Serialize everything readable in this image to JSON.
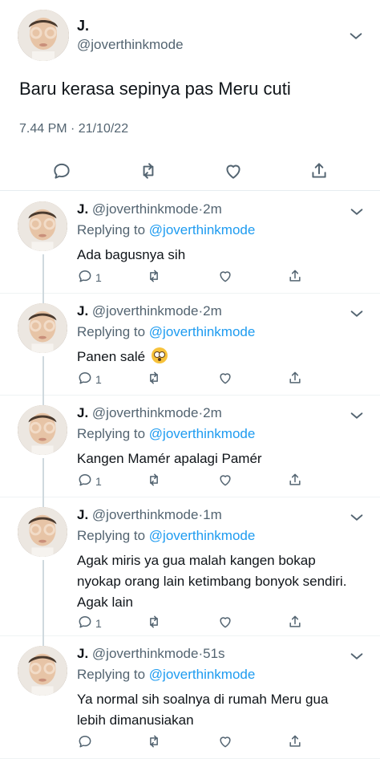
{
  "main_tweet": {
    "name": "J.",
    "handle": "@joverthinkmode",
    "text": "Baru kerasa sepinya pas Meru cuti",
    "timestamp": "7.44 PM · 21/10/22",
    "actions": [
      "reply-icon",
      "retweet-icon",
      "like-icon",
      "share-icon"
    ]
  },
  "replies": [
    {
      "name": "J.",
      "handle": "@joverthinkmode",
      "time": "2m",
      "replying_label": "Replying to",
      "replying_to": "@joverthinkmode",
      "text": "Ada bagusnya sih",
      "reply_count": "1",
      "emoji": false
    },
    {
      "name": "J.",
      "handle": "@joverthinkmode",
      "time": "2m",
      "replying_label": "Replying to",
      "replying_to": "@joverthinkmode",
      "text": "Panen salé",
      "reply_count": "1",
      "emoji": true
    },
    {
      "name": "J.",
      "handle": "@joverthinkmode",
      "time": "2m",
      "replying_label": "Replying to",
      "replying_to": "@joverthinkmode",
      "text": "Kangen Mamér apalagi Pamér",
      "reply_count": "1",
      "emoji": false
    },
    {
      "name": "J.",
      "handle": "@joverthinkmode",
      "time": "1m",
      "replying_label": "Replying to",
      "replying_to": "@joverthinkmode",
      "text": "Agak miris ya gua malah kangen bokap nyokap orang lain ketimbang bonyok sendiri. Agak lain",
      "reply_count": "1",
      "emoji": false
    },
    {
      "name": "J.",
      "handle": "@joverthinkmode",
      "time": "51s",
      "replying_label": "Replying to",
      "replying_to": "@joverthinkmode",
      "text": "Ya normal sih soalnya di rumah Meru gua lebih dimanusiakan",
      "reply_count": "",
      "emoji": false
    }
  ],
  "colors": {
    "link": "#1d9bf0",
    "muted": "#536471",
    "text": "#0f1419",
    "divider": "#e6ecf0"
  }
}
